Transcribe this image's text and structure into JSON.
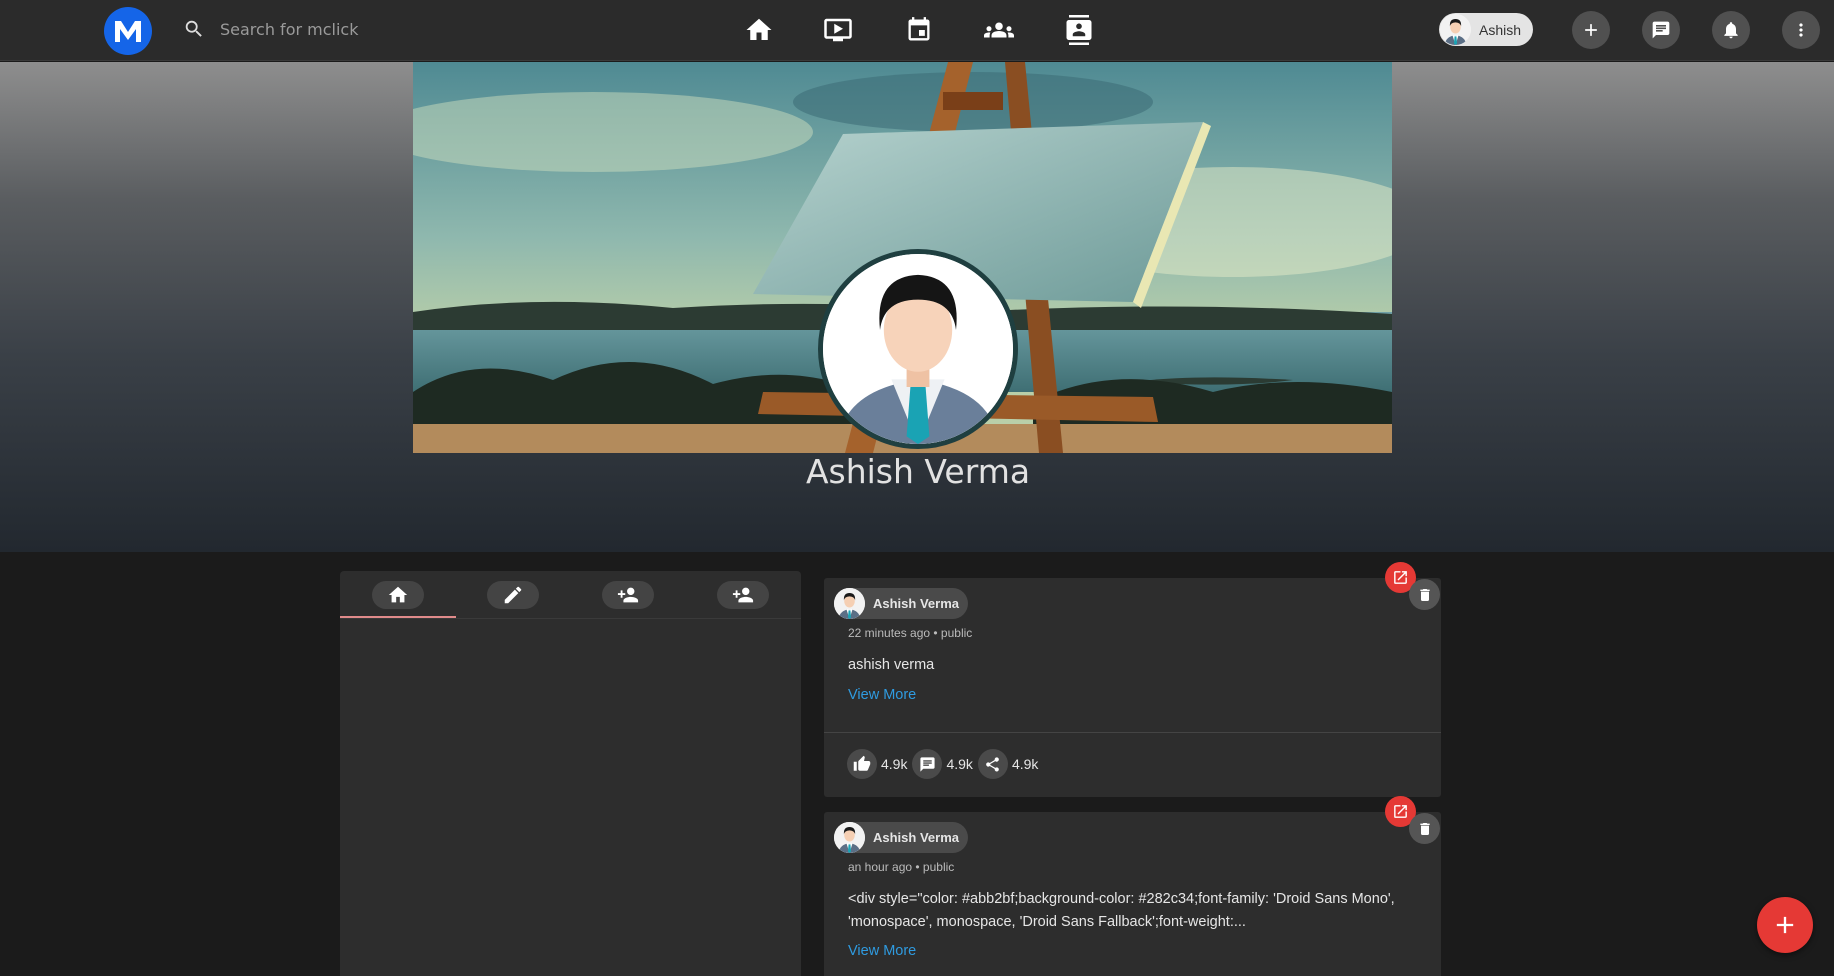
{
  "app": {
    "logo_letter": "M",
    "brand_color": "#1565e8",
    "accent_color": "#e53935",
    "link_color": "#2f9be0"
  },
  "header": {
    "search_placeholder": "Search for mclick",
    "nav_icons": [
      "home-icon",
      "video-icon",
      "calendar-icon",
      "groups-icon",
      "contacts-icon"
    ],
    "user_chip_label": "Ashish",
    "action_icons": [
      "add-icon",
      "chat-icon",
      "bell-icon",
      "more-vert-icon"
    ]
  },
  "profile": {
    "name": "Ashish Verma"
  },
  "left_panel": {
    "tabs": [
      "home-icon",
      "edit-icon",
      "add-friend-icon",
      "add-friend-icon"
    ],
    "active_tab": 0
  },
  "posts": [
    {
      "author": "Ashish Verma",
      "time": "22 minutes ago",
      "visibility": "public",
      "meta": "22 minutes ago • public",
      "text": "ashish verma",
      "view_more": "View More",
      "likes": "4.9k",
      "comments": "4.9k",
      "shares": "4.9k"
    },
    {
      "author": "Ashish Verma",
      "time": "an hour ago",
      "visibility": "public",
      "meta": "an hour ago • public",
      "text": "<div style=\"color: #abb2bf;background-color: #282c34;font-family: 'Droid Sans Mono', 'monospace', monospace, 'Droid Sans Fallback';font-weight:...",
      "view_more": "View More"
    }
  ]
}
